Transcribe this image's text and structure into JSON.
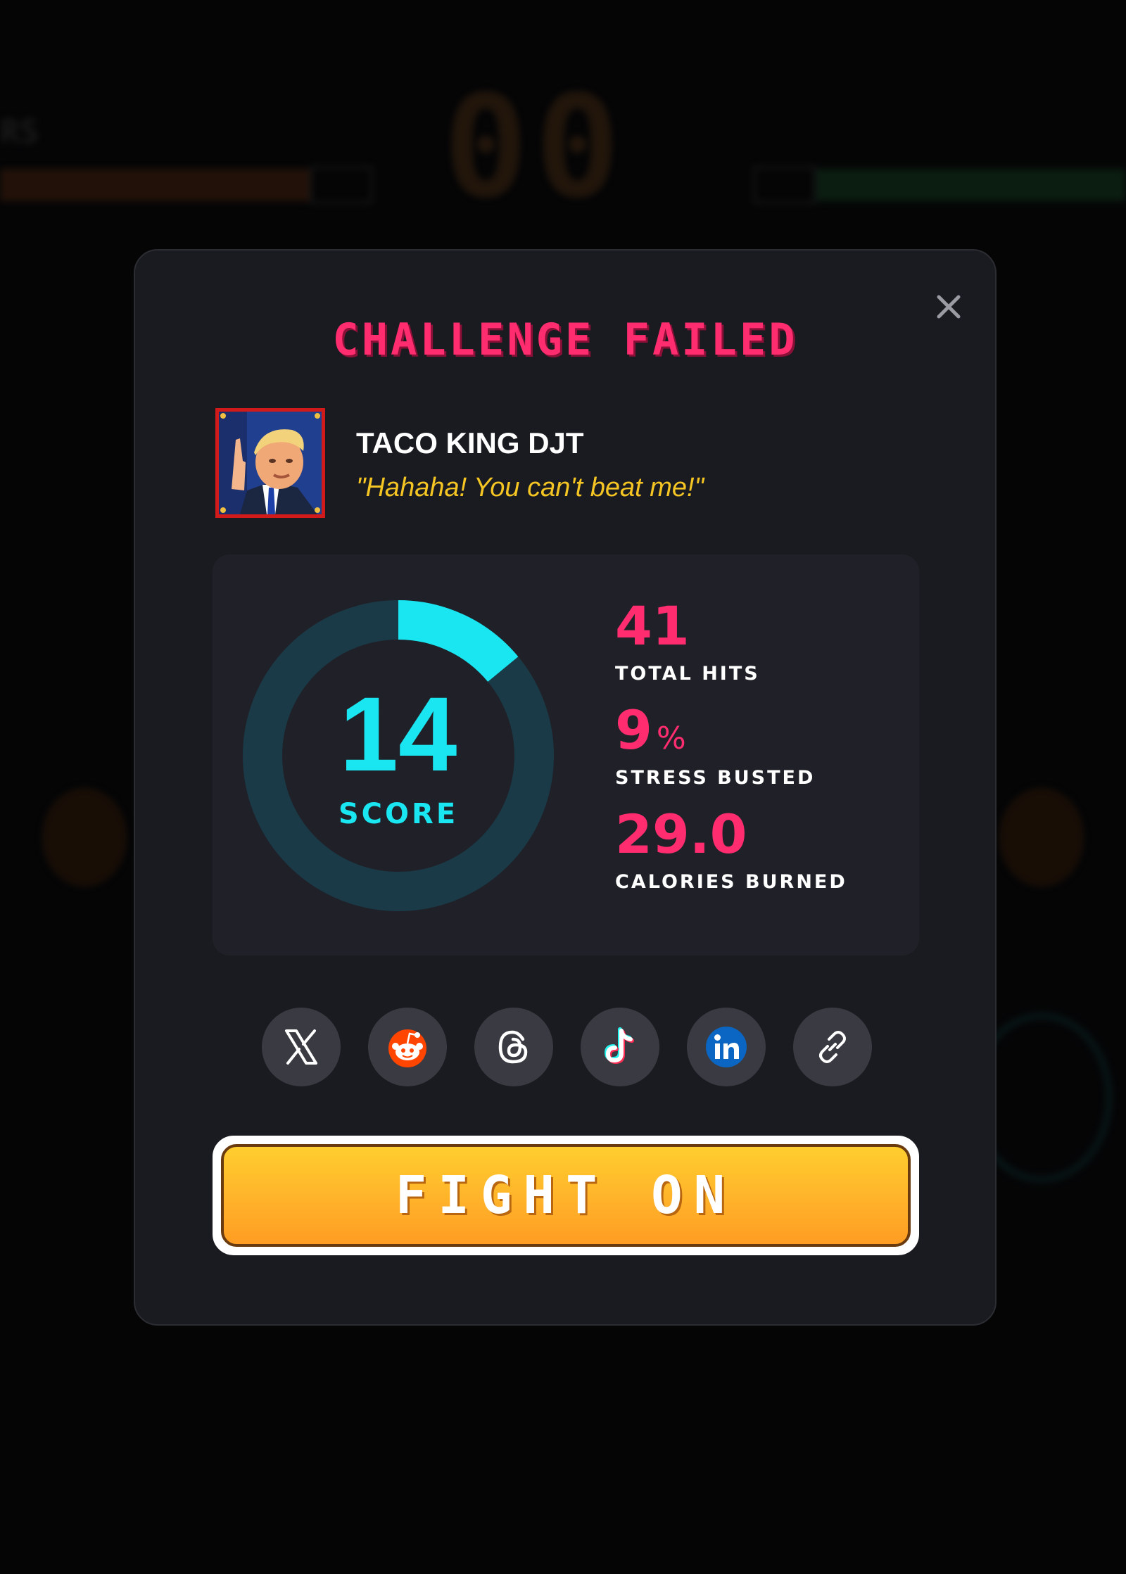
{
  "backdrop": {
    "timer": "00",
    "player_name": "RS"
  },
  "modal": {
    "title": "CHALLENGE FAILED",
    "close_icon": "close-icon"
  },
  "opponent": {
    "name": "TACO KING DJT",
    "quote": "\"Hahaha! You can't beat me!\"",
    "avatar_icon": "opponent-portrait"
  },
  "score": {
    "value": "14",
    "label": "SCORE",
    "progress_fraction": 0.14
  },
  "stats": {
    "hits": {
      "value": "41",
      "label": "TOTAL HITS"
    },
    "stress": {
      "value": "9",
      "unit": "%",
      "label": "STRESS BUSTED"
    },
    "calories": {
      "value": "29.0",
      "label": "CALORIES BURNED"
    }
  },
  "share": {
    "buttons": [
      {
        "name": "x-icon"
      },
      {
        "name": "reddit-icon"
      },
      {
        "name": "threads-icon"
      },
      {
        "name": "tiktok-icon"
      },
      {
        "name": "linkedin-icon"
      },
      {
        "name": "link-icon"
      }
    ]
  },
  "action": {
    "fight_label": "FIGHT ON"
  },
  "colors": {
    "accent_pink": "#ff2d6f",
    "accent_cyan": "#19e6f0",
    "quote_yellow": "#f5c623",
    "button_orange": "#ffb02a",
    "modal_bg": "#1a1b20",
    "ring_track": "#1a3a48"
  }
}
